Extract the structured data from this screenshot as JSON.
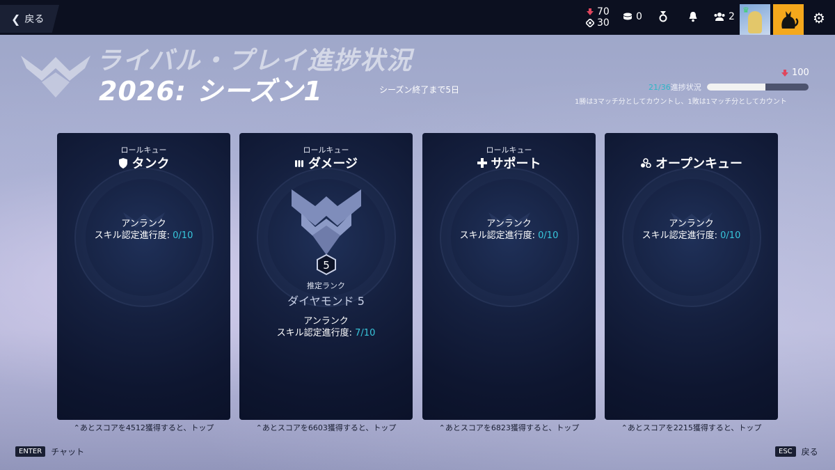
{
  "top_bar": {
    "back_label": "戻る",
    "competitive_points": "70",
    "legacy_points": "30",
    "coins": "0",
    "group_count": "2"
  },
  "header": {
    "title": "ライバル・プレイ進捗状況",
    "season": "2026: シーズン1",
    "season_remaining": "シーズン終了まで5日"
  },
  "progress": {
    "reward_points": "100",
    "count": "21/36",
    "label": "進捗状況",
    "fraction": 0.58,
    "note": "1勝は3マッチ分としてカウントし、1敗は1マッチ分としてカウント"
  },
  "cards": [
    {
      "queue": "ロールキュー",
      "role": "タンク",
      "role_icon": "shield-icon",
      "status": "アンランク",
      "progress_label": "スキル認定進行度:",
      "progress_value": "0/10",
      "footer": "あとスコアを4512獲得すると、トップ"
    },
    {
      "queue": "ロールキュー",
      "role": "ダメージ",
      "role_icon": "bullets-icon",
      "rank_division": "5",
      "rank_sub": "推定ランク",
      "rank_name": "ダイヤモンド 5",
      "status": "アンランク",
      "progress_label": "スキル認定進行度:",
      "progress_value": "7/10",
      "footer": "あとスコアを6603獲得すると、トップ"
    },
    {
      "queue": "ロールキュー",
      "role": "サポート",
      "role_icon": "cross-icon",
      "status": "アンランク",
      "progress_label": "スキル認定進行度:",
      "progress_value": "0/10",
      "footer": "あとスコアを6823獲得すると、トップ"
    },
    {
      "queue": "",
      "role": "オープンキュー",
      "role_icon": "three-circles-icon",
      "status": "アンランク",
      "progress_label": "スキル認定進行度:",
      "progress_value": "0/10",
      "footer": "あとスコアを2215獲得すると、トップ"
    }
  ],
  "footer": {
    "chat_key": "ENTER",
    "chat_label": "チャット",
    "back_key": "ESC",
    "back_label": "戻る"
  },
  "colors": {
    "accent_cyan": "#38c7dc",
    "competitive_red": "#e0465d",
    "card_bg": "#0e1630"
  }
}
